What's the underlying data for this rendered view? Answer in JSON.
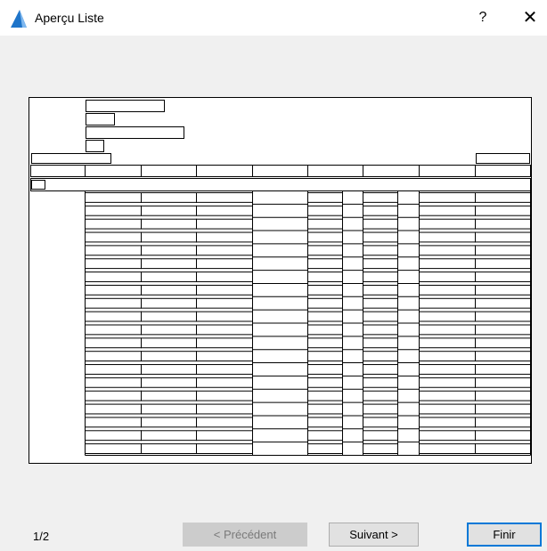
{
  "window": {
    "title": "Aperçu Liste",
    "icon": "archicad-icon",
    "help_glyph": "?",
    "close_glyph": "✕"
  },
  "preview": {
    "description_icon": "list-preview-thumbnail",
    "body_row_count": 20
  },
  "footer": {
    "page_indicator": "1/2",
    "prev_label": "< Précédent",
    "prev_enabled": false,
    "next_label": "Suivant >",
    "finish_label": "Finir"
  },
  "colors": {
    "accent": "#0078d7",
    "icon_blue": "#1e74c9",
    "disabled_bg": "#cccccc",
    "disabled_text": "#7a7a7a"
  }
}
